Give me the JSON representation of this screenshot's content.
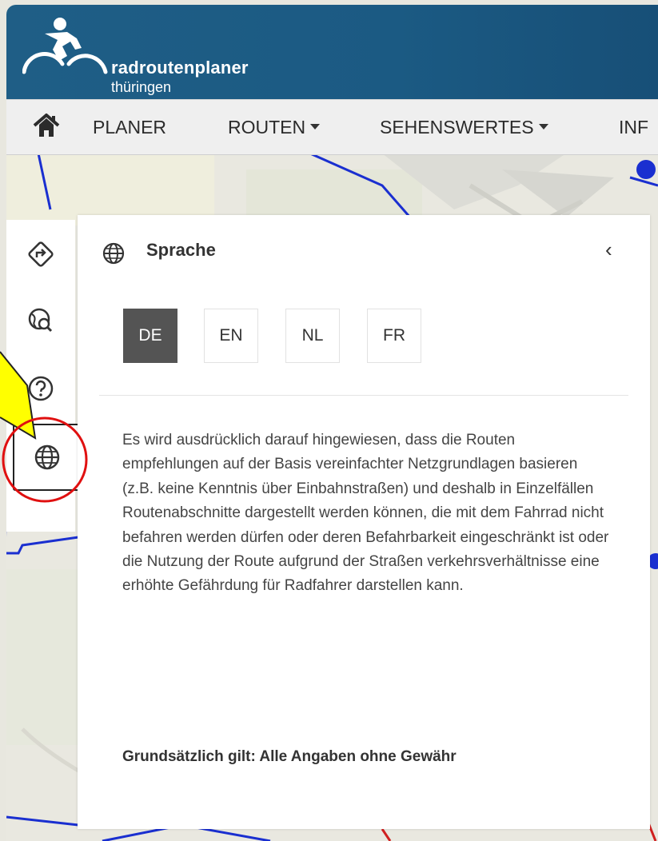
{
  "brand": {
    "name": "radroutenplaner",
    "region": "thüringen"
  },
  "nav": {
    "home_icon": "home-icon",
    "items": [
      {
        "label": "PLANER",
        "has_dropdown": false
      },
      {
        "label": "ROUTEN",
        "has_dropdown": true
      },
      {
        "label": "SEHENSWERTES",
        "has_dropdown": true
      },
      {
        "label": "INF",
        "has_dropdown": false
      }
    ]
  },
  "toolbar": {
    "items": [
      {
        "icon": "route-directions-icon",
        "active": false
      },
      {
        "icon": "map-search-icon",
        "active": false
      },
      {
        "icon": "help-icon",
        "active": false
      },
      {
        "icon": "globe-icon",
        "active": true
      }
    ]
  },
  "panel": {
    "title": "Sprache",
    "title_icon": "globe-icon",
    "collapse_icon": "chevron-left-icon",
    "collapse_label": "‹",
    "languages": [
      {
        "code": "DE",
        "active": true
      },
      {
        "code": "EN",
        "active": false
      },
      {
        "code": "NL",
        "active": false
      },
      {
        "code": "FR",
        "active": false
      }
    ],
    "disclaimer": "Es wird ausdrücklich darauf hingewiesen, dass die Routen empfehlungen auf der Basis vereinfachter Netzgrundlagen basieren (z.B. keine Kenntnis über Einbahnstraßen) und deshalb in Einzelfällen Routenabschnitte dargestellt werden können, die mit dem Fahrrad nicht befahren werden dürfen oder deren Befahrbarkeit eingeschränkt ist oder die Nutzung der Route aufgrund der Straßen verkehrsverhältnisse eine erhöhte Gefährdung für Radfahrer darstellen kann.",
    "disclaimer_bold": "Grundsätzlich gilt: Alle Angaben ohne Gewähr"
  },
  "colors": {
    "header": "#1b5a83",
    "active_language": "#545454",
    "route_lines": "#1a2fd0",
    "annotation_arrow": "#ffff00",
    "annotation_circle": "#e01010"
  }
}
